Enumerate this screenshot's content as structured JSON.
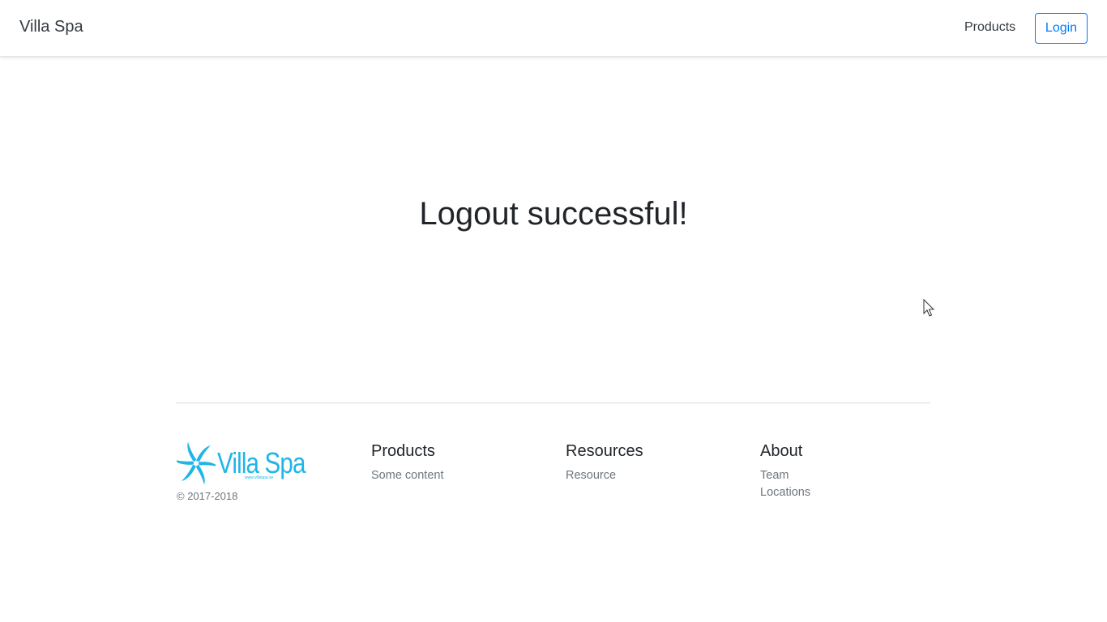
{
  "navbar": {
    "brand": "Villa Spa",
    "links": [
      {
        "label": "Products"
      }
    ],
    "login_label": "Login"
  },
  "main": {
    "message": "Logout successful!"
  },
  "footer": {
    "logo": {
      "text": "Villa Spa",
      "subtext": "www.villaspa.se",
      "color": "#1fb5e8"
    },
    "copyright": "© 2017-2018",
    "columns": [
      {
        "title": "Products",
        "items": [
          "Some content"
        ]
      },
      {
        "title": "Resources",
        "items": [
          "Resource"
        ]
      },
      {
        "title": "About",
        "items": [
          "Team",
          "Locations"
        ]
      }
    ]
  },
  "colors": {
    "accent": "#007bff",
    "muted": "#6c757d",
    "text": "#212529"
  }
}
